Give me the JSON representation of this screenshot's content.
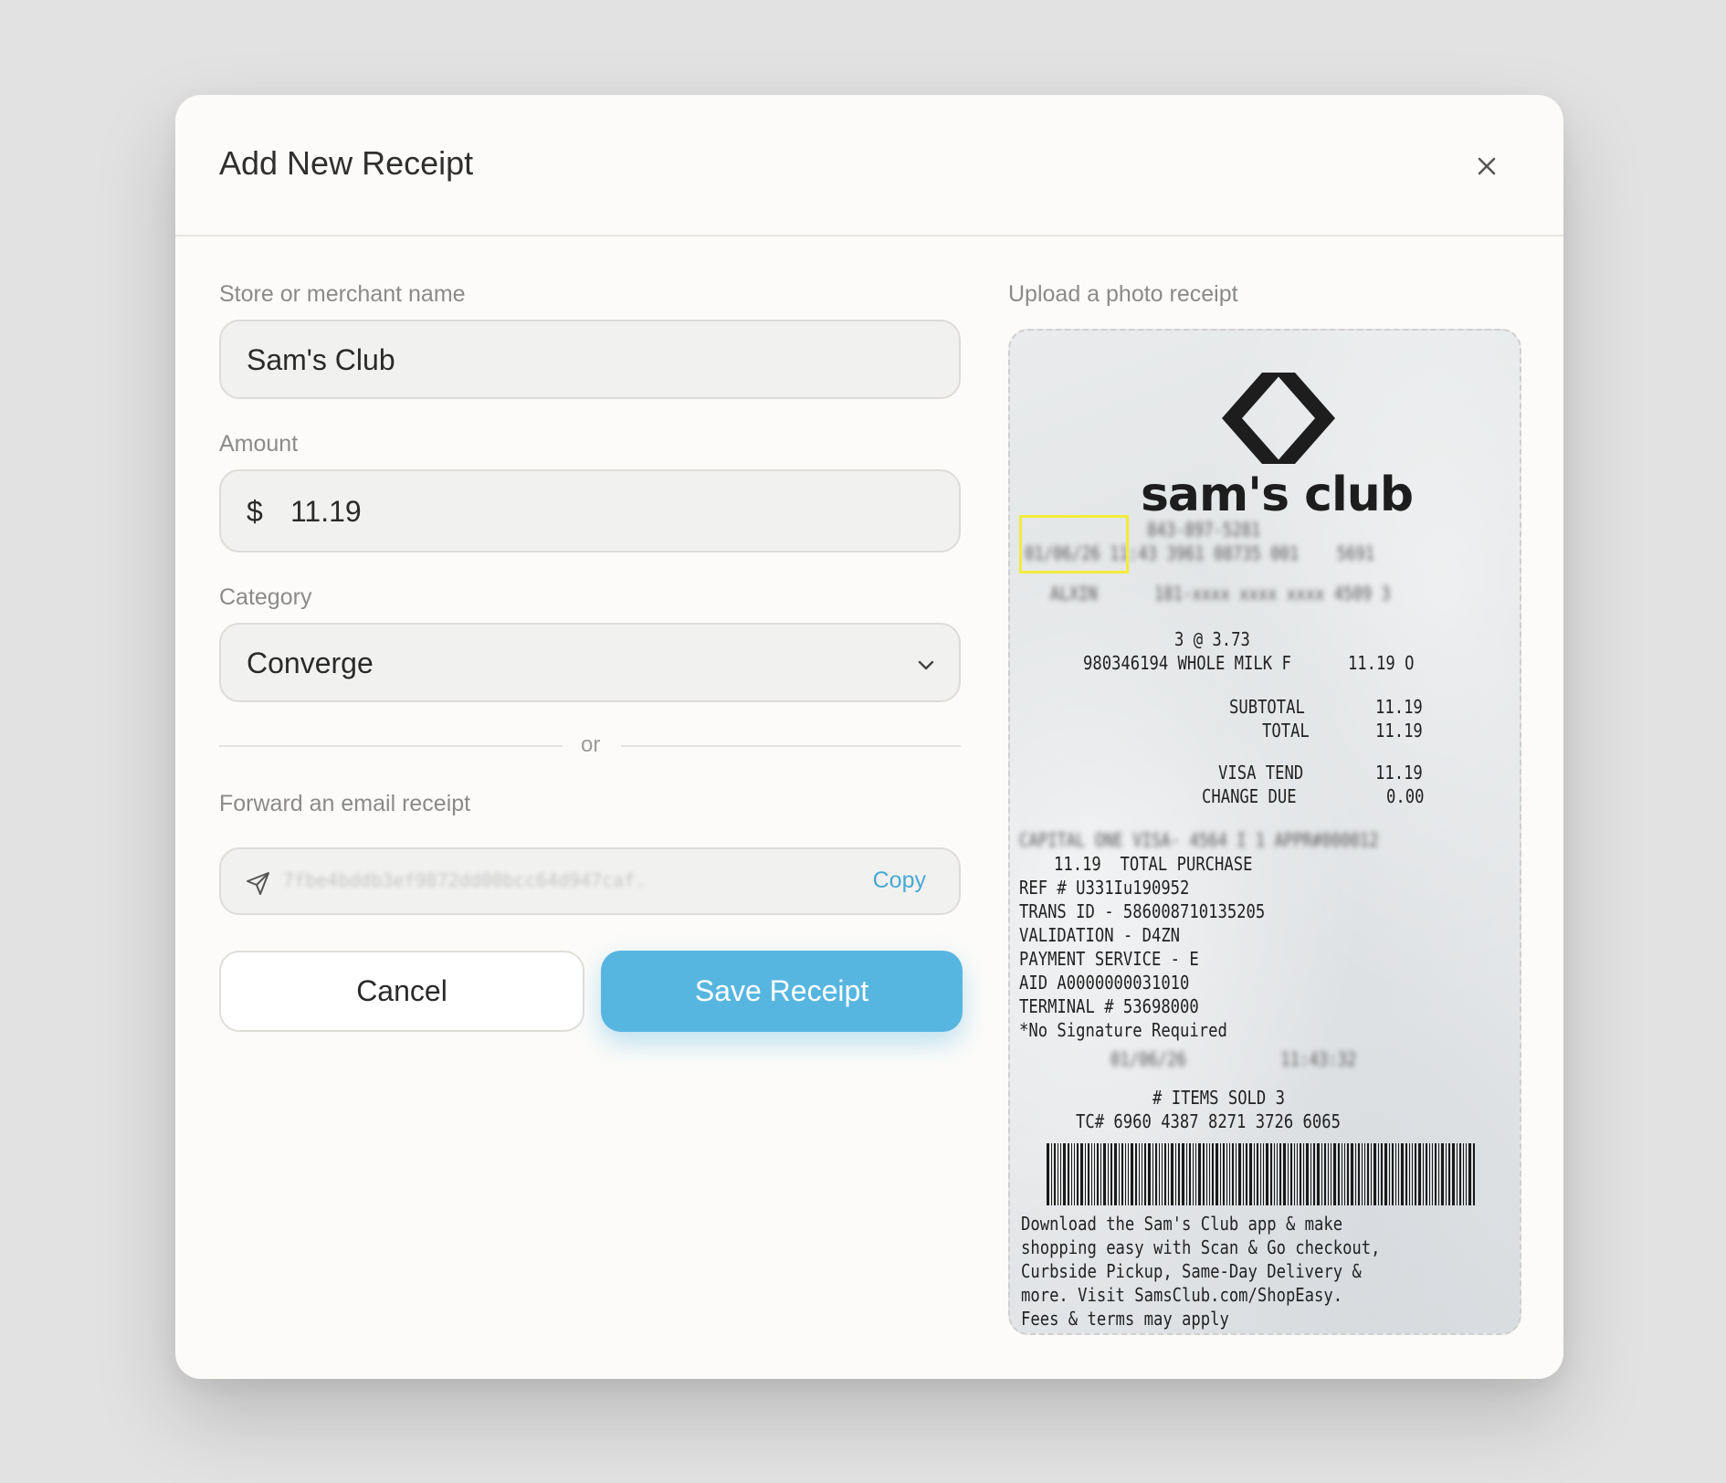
{
  "modal": {
    "title": "Add New Receipt"
  },
  "form": {
    "merchant": {
      "label": "Store or merchant name",
      "value": "Sam's Club"
    },
    "amount": {
      "label": "Amount",
      "currency_symbol": "$",
      "value": "11.19"
    },
    "category": {
      "label": "Category",
      "selected": "Converge"
    },
    "divider_text": "or",
    "email_forward": {
      "label": "Forward an email receipt",
      "address": "7fbe4bddb3ef9872dd00bcc64d947caf.",
      "copy_label": "Copy"
    },
    "buttons": {
      "cancel": "Cancel",
      "save": "Save Receipt"
    }
  },
  "upload": {
    "label": "Upload a photo receipt",
    "receipt": {
      "brand": "sam's club",
      "header_blurred_1": "843-897-5281",
      "header_blurred_2": "01/06/26 11:43 3961 08735 001    5691",
      "header_blurred_3": "ALXIN      181-xxxx xxxx xxxx 4509 3",
      "qty_line": "3 @ 3.73",
      "item_line": "980346194 WHOLE MILK F      11.19 O",
      "subtotal_label": "SUBTOTAL",
      "subtotal_value": "11.19",
      "total_label": "TOTAL",
      "total_value": "11.19",
      "visa_label": "VISA TEND",
      "visa_value": "11.19",
      "change_label": "CHANGE DUE",
      "change_value": "0.00",
      "card_blurred": "CAPITAL ONE VISA- 4564 I 1 APPR#000012",
      "total_purchase": "11.19  TOTAL PURCHASE",
      "ref": "REF # U331Iu190952",
      "trans_id": "TRANS ID - 586008710135205",
      "validation": "VALIDATION - D4ZN",
      "payment_service": "PAYMENT SERVICE - E",
      "aid": "AID A0000000031010",
      "terminal": "TERMINAL # 53698000",
      "signature": "*No Signature Required",
      "date_blurred": "01/06/26          11:43:32",
      "items_sold": "# ITEMS SOLD 3",
      "tc": "TC# 6960 4387 8271 3726 6065",
      "footer_1": "Download the Sam's Club app & make",
      "footer_2": "shopping easy with Scan & Go checkout,",
      "footer_3": "Curbside Pickup, Same-Day Delivery &",
      "footer_4": "more. Visit SamsClub.com/ShopEasy.",
      "footer_5": "Fees & terms may apply"
    }
  },
  "icons": {
    "close": "close-icon",
    "chevron": "chevron-down-icon",
    "send": "send-icon",
    "logo": "sams-club-logo"
  },
  "colors": {
    "accent": "#57b6e0",
    "link": "#4aa8d4",
    "highlight": "#f1ec3c"
  }
}
